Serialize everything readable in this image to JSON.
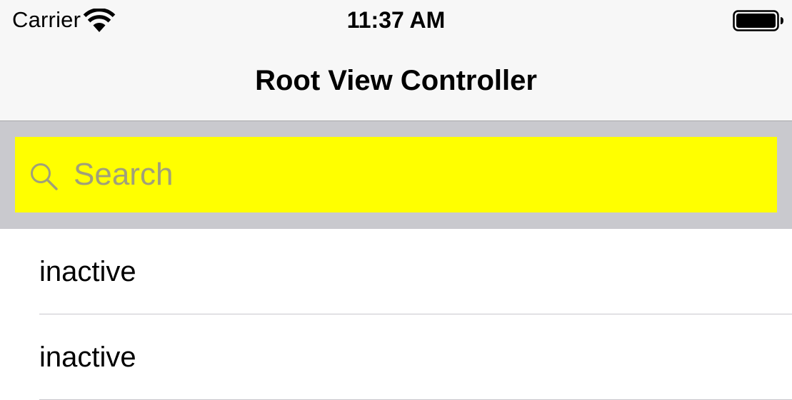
{
  "status_bar": {
    "carrier": "Carrier",
    "time": "11:37 AM",
    "wifi_icon": "wifi-icon",
    "battery_icon": "battery-full-icon"
  },
  "nav_bar": {
    "title": "Root View Controller"
  },
  "search": {
    "placeholder": "Search",
    "value": "",
    "icon": "search-icon",
    "field_color": "#ffff00",
    "bar_color": "#c9c9ce"
  },
  "table": {
    "rows": [
      {
        "label": "inactive"
      },
      {
        "label": "inactive"
      }
    ]
  }
}
